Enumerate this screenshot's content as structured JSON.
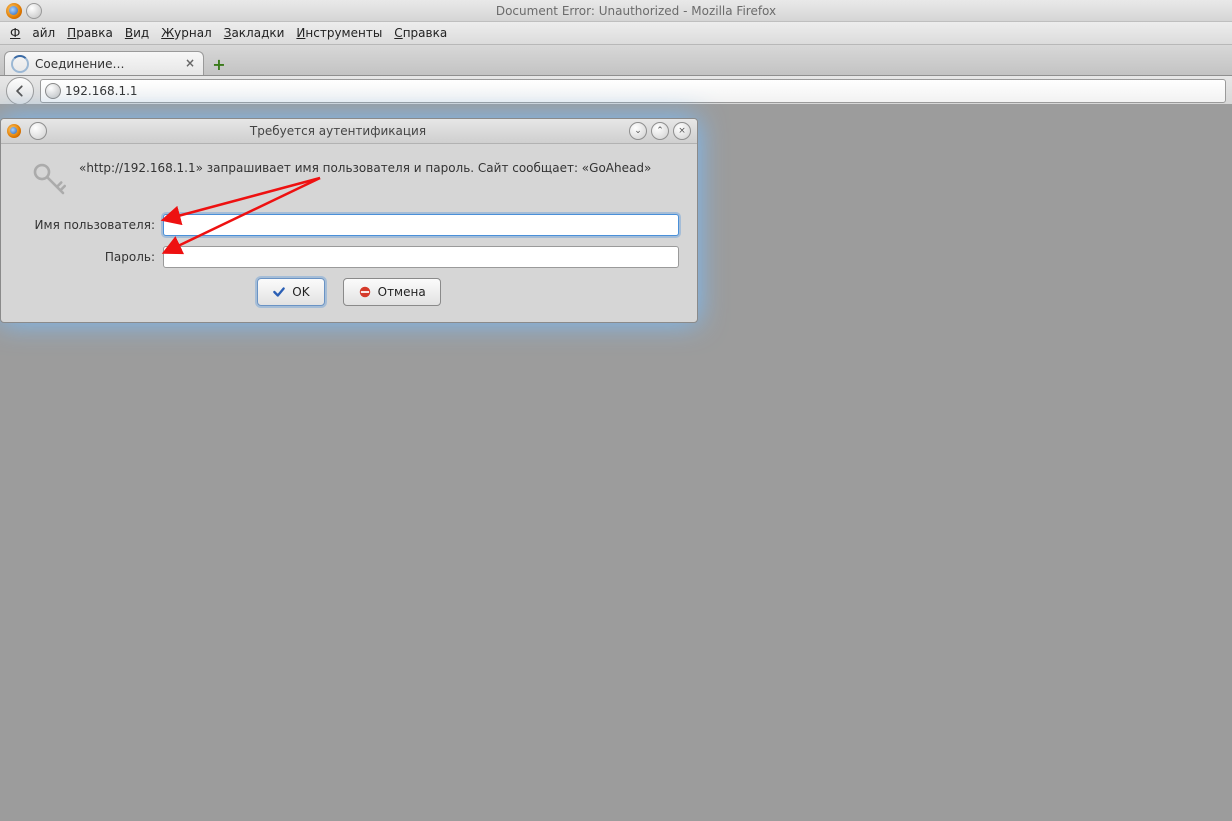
{
  "window": {
    "title": "Document Error: Unauthorized - Mozilla Firefox"
  },
  "menubar": {
    "file": "Файл",
    "edit": "Правка",
    "view": "Вид",
    "journal": "Журнал",
    "bookmarks": "Закладки",
    "tools": "Инструменты",
    "help": "Справка"
  },
  "tab": {
    "title": "Соединение…",
    "close": "×",
    "newtab": "+"
  },
  "address": {
    "url": "192.168.1.1"
  },
  "dialog": {
    "title": "Требуется аутентификация",
    "message": "«http://192.168.1.1» запрашивает имя пользователя и пароль. Сайт сообщает: «GoAhead»",
    "username_label": "Имя пользователя:",
    "password_label": "Пароль:",
    "username_value": "",
    "password_value": "",
    "ok": "OK",
    "cancel": "Отмена"
  },
  "icons": {
    "back": "back",
    "globe": "globe",
    "key": "key",
    "check": "check",
    "forbid": "forbid",
    "min": "⌄",
    "max": "⌃",
    "close": "×"
  }
}
